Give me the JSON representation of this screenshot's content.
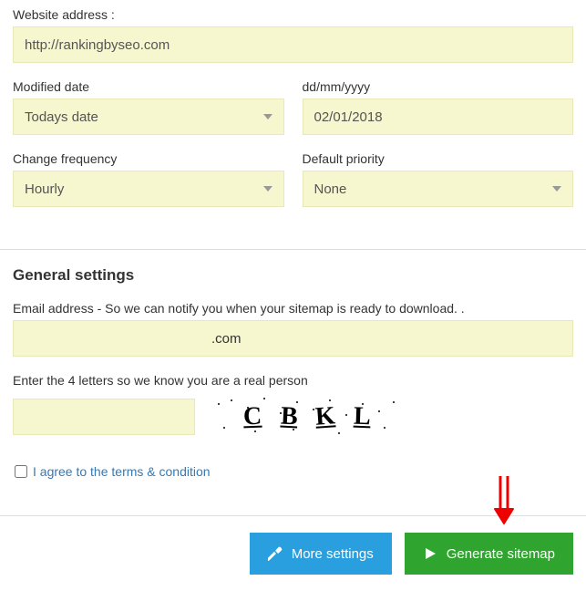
{
  "website": {
    "label": "Website address :",
    "value": "http://rankingbyseo.com"
  },
  "modified_date": {
    "label": "Modified date",
    "value": "Todays date"
  },
  "date_format": {
    "label": "dd/mm/yyyy",
    "value": "02/01/2018"
  },
  "change_frequency": {
    "label": "Change frequency",
    "value": "Hourly"
  },
  "default_priority": {
    "label": "Default priority",
    "value": "None"
  },
  "general": {
    "heading": "General settings",
    "email_label": "Email address - So we can notify you when your sitemap is ready to download. .",
    "email_suffix": ".com",
    "captcha_label": "Enter the 4 letters so we know you are a real person",
    "captcha_letters": [
      "C",
      "B",
      "K",
      "L"
    ],
    "agree_label": "I agree to the terms & condition"
  },
  "buttons": {
    "more": "More settings",
    "generate": "Generate sitemap"
  }
}
